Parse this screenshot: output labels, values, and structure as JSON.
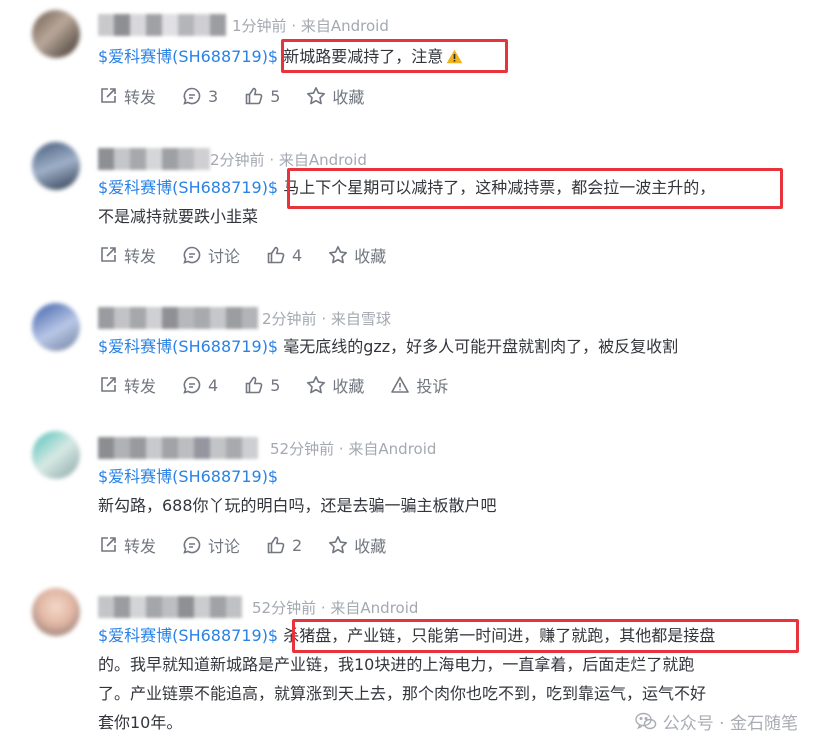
{
  "stock_tag": "$爱科赛博(SH688719)$",
  "actions": {
    "repost": "转发",
    "discuss": "讨论",
    "bookmark": "收藏",
    "report": "投诉"
  },
  "posts": [
    {
      "time": "1分钟前",
      "source": "· 来自Android",
      "lines": [
        "新城路要减持了，注意"
      ],
      "comment_count": "3",
      "like_count": "5"
    },
    {
      "time": "2分钟前",
      "source": "· 来自Android",
      "lines": [
        "马上下个星期可以减持了，这种减持票，都会拉一波主升的，",
        "不是减持就要跌小韭菜"
      ],
      "like_count": "4"
    },
    {
      "time": "2分钟前",
      "source": "· 来自雪球",
      "lines": [
        "毫无底线的gzz，好多人可能开盘就割肉了，被反复收割"
      ],
      "comment_count": "4",
      "like_count": "5"
    },
    {
      "time": "52分钟前",
      "source": "· 来自Android",
      "lines": [
        "新勾路，688你丫玩的明白吗，还是去骗一骗主板散户吧"
      ],
      "like_count": "2"
    },
    {
      "time": "52分钟前",
      "source": "· 来自Android",
      "lines": [
        "杀猪盘，产业链，只能第一时间进，赚了就跑，其他都是接盘",
        "的。我早就知道新城路是产业链，我10块进的上海电力，一直拿着，后面走烂了就跑",
        "了。产业链票不能追高，就算涨到天上去，那个肉你也吃不到，吃到靠运气，运气不好",
        "套你10年。"
      ]
    }
  ],
  "watermark": "公众号 · 金石随笔"
}
